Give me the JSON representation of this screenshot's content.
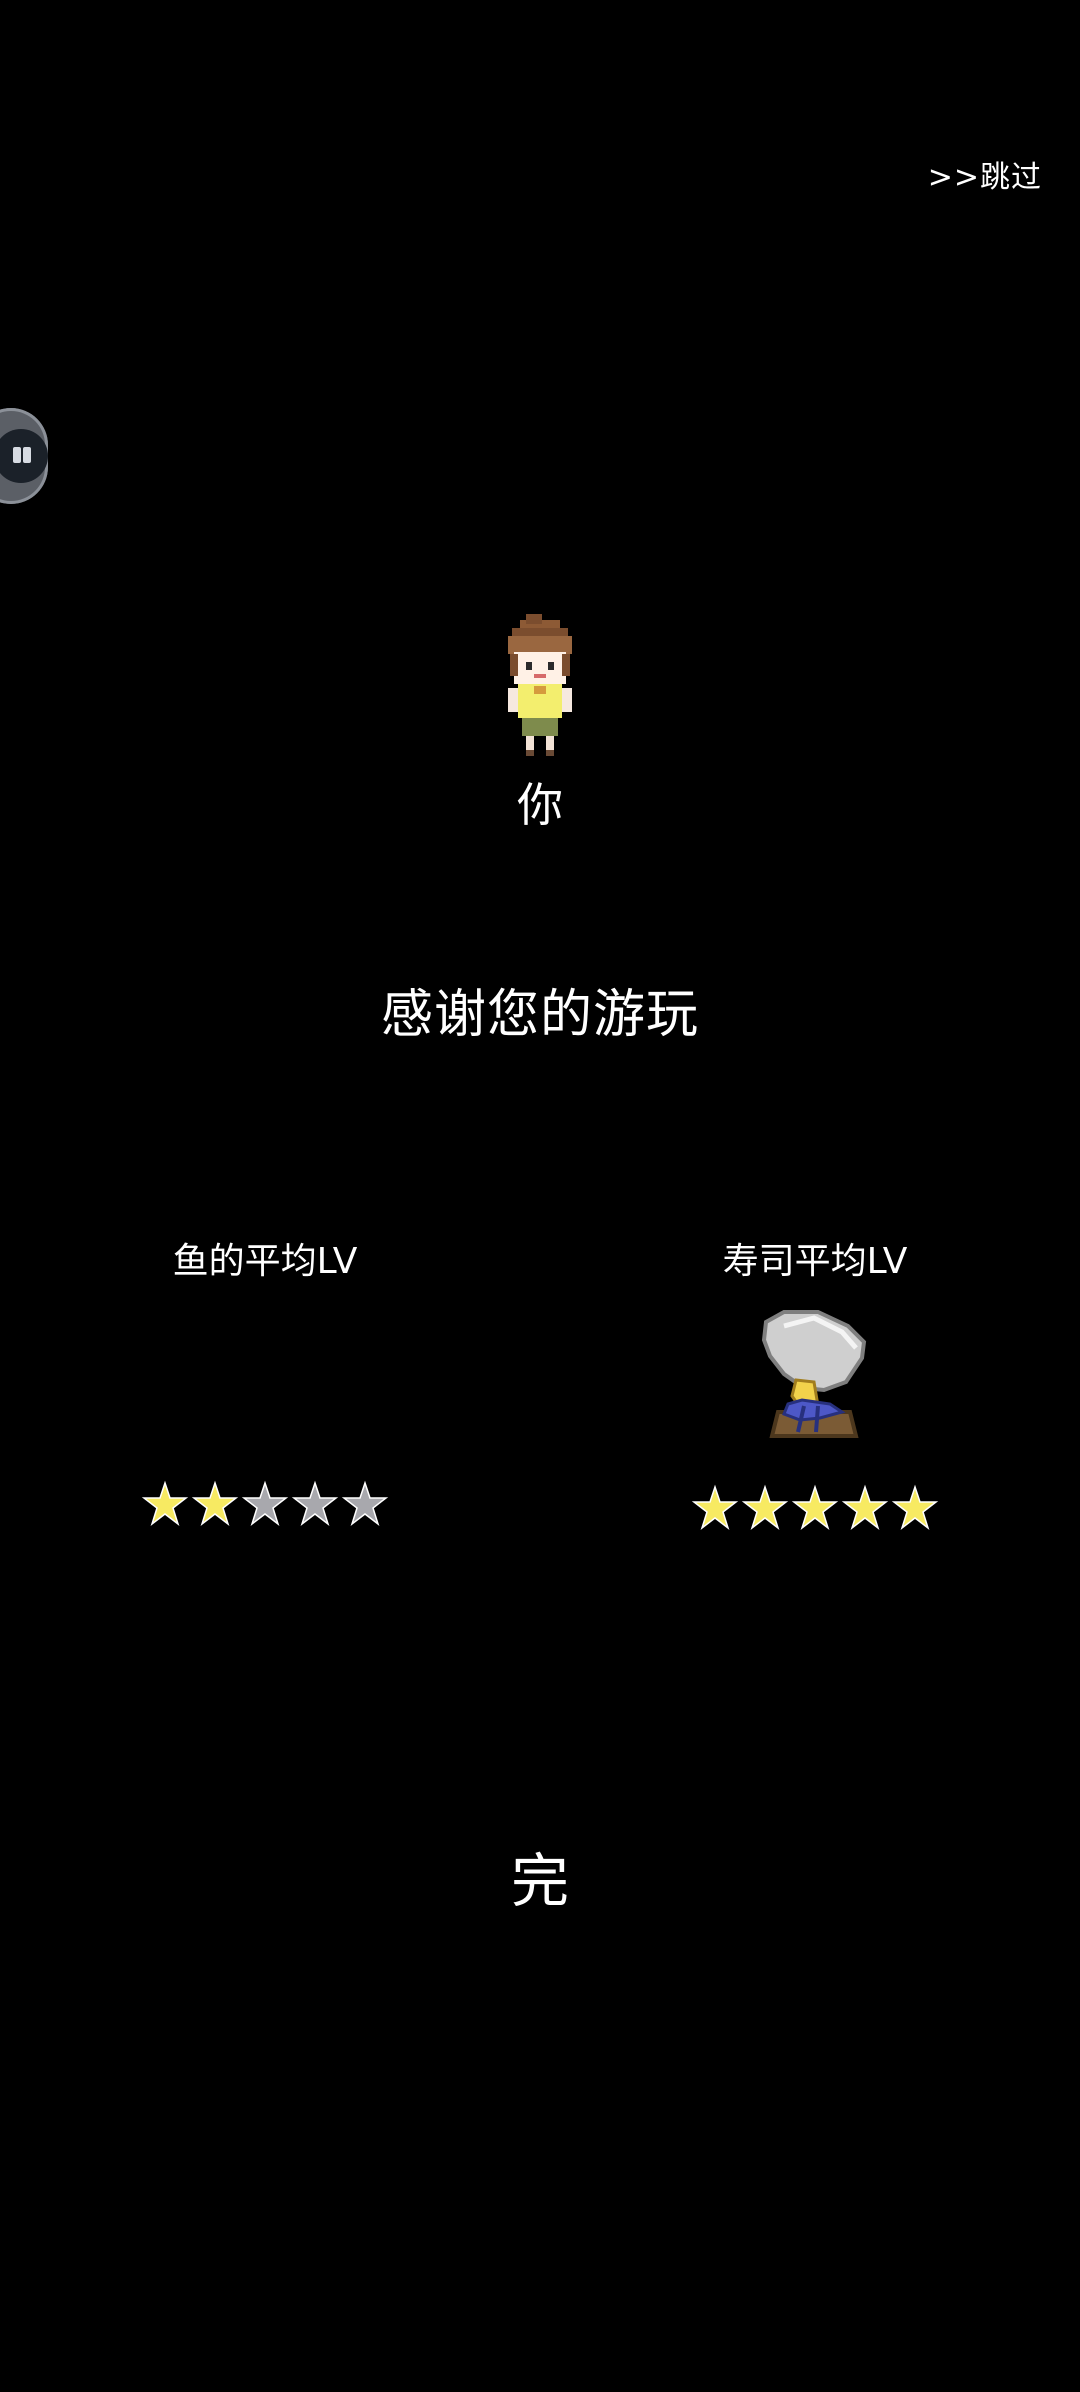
{
  "skip": "跳过",
  "player_label": "你",
  "thanks": "感谢您的游玩",
  "fish_stat": {
    "title": "鱼的平均LV",
    "rating": 2,
    "max": 5
  },
  "sushi_stat": {
    "title": "寿司平均LV",
    "rating": 5,
    "max": 5
  },
  "end_text": "完",
  "colors": {
    "background": "#000000",
    "star_filled": "#f7ea62",
    "star_empty": "#a8a8ad"
  }
}
